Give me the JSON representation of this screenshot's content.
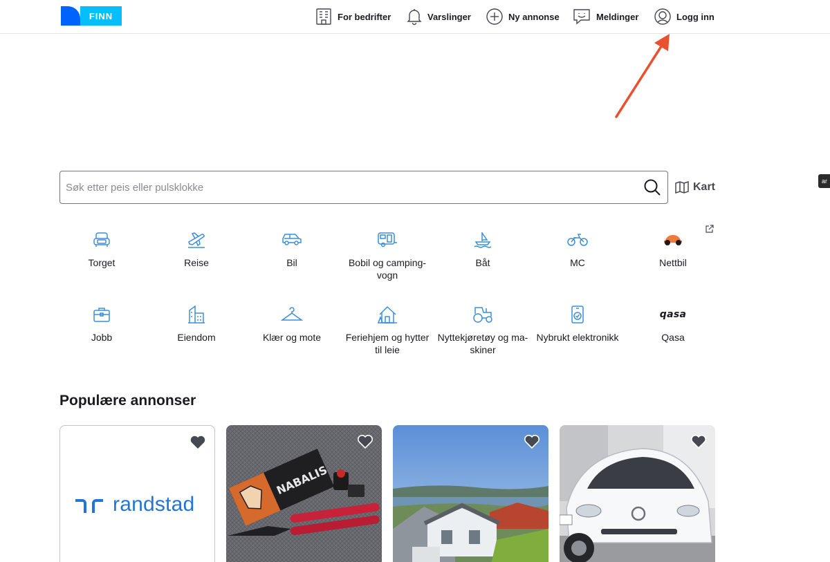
{
  "header": {
    "logo_text": "FINN",
    "nav": [
      {
        "label": "For bedrifter",
        "icon": "building-icon"
      },
      {
        "label": "Varslinger",
        "icon": "bell-icon"
      },
      {
        "label": "Ny annonse",
        "icon": "plus-circle-icon"
      },
      {
        "label": "Meldinger",
        "icon": "message-icon"
      },
      {
        "label": "Logg inn",
        "icon": "user-circle-icon"
      }
    ]
  },
  "side_tag": "ar",
  "search": {
    "placeholder": "Søk etter peis eller pulsklokke",
    "map_label": "Kart"
  },
  "categories": [
    {
      "label": "Torget",
      "icon": "sofa-icon"
    },
    {
      "label": "Reise",
      "icon": "plane-icon"
    },
    {
      "label": "Bil",
      "icon": "car-icon"
    },
    {
      "label": "Bobil og camping-vogn",
      "line1": "Bobil og camping-",
      "line2": "vogn",
      "icon": "caravan-icon"
    },
    {
      "label": "Båt",
      "icon": "boat-icon"
    },
    {
      "label": "MC",
      "icon": "motorcycle-icon"
    },
    {
      "label": "Nettbil",
      "icon": "nettbil-logo-icon"
    },
    {
      "label": "Jobb",
      "icon": "briefcase-icon"
    },
    {
      "label": "Eiendom",
      "icon": "buildings-icon"
    },
    {
      "label": "Klær og mote",
      "icon": "hanger-icon"
    },
    {
      "label": "Feriehjem og hytter til leie",
      "line1": "Feriehjem og hytter",
      "line2": "til leie",
      "icon": "cabin-icon"
    },
    {
      "label": "Nyttekjøretøy og maskiner",
      "line1": "Nyttekjøretøy og ma-",
      "line2": "skiner",
      "icon": "tractor-icon"
    },
    {
      "label": "Nybrukt elektronikk",
      "icon": "phone-check-icon"
    },
    {
      "label": "Qasa",
      "icon": "qasa-logo-icon",
      "logo_text": "qasa"
    }
  ],
  "popular": {
    "title": "Populære annonser",
    "cards": [
      {
        "kind": "brand",
        "brand_text": "randstad"
      },
      {
        "kind": "photo",
        "subject": "knife-product"
      },
      {
        "kind": "photo",
        "subject": "house-view"
      },
      {
        "kind": "photo",
        "subject": "white-car"
      }
    ]
  },
  "colors": {
    "accent": "#0063fb",
    "accent_light": "#06befb",
    "icon_blue": "#3b8ddb",
    "annotation_arrow": "#e8502f"
  }
}
